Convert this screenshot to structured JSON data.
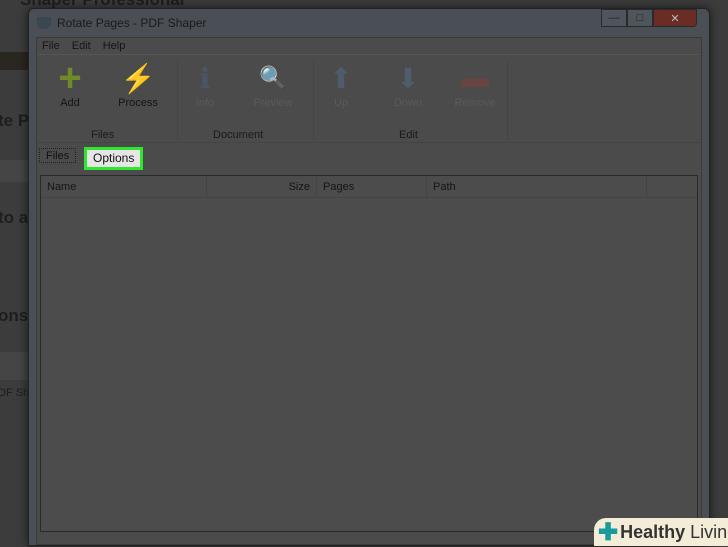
{
  "background": {
    "fragments": [
      "Shaper Professional",
      "te Pa",
      "to ad",
      "ons f",
      "DF Sha"
    ]
  },
  "window": {
    "title": "Rotate Pages - PDF Shaper",
    "minimize": "—",
    "maximize": "□",
    "close": "✕"
  },
  "menu": [
    "File",
    "Edit",
    "Help"
  ],
  "toolbar": {
    "buttons": [
      {
        "label": "Add",
        "icon": "+",
        "enabled": true
      },
      {
        "label": "Process",
        "icon": "⚡",
        "enabled": true
      },
      {
        "label": "Info",
        "icon": "ℹ",
        "enabled": false
      },
      {
        "label": "Preview",
        "icon": "🔍",
        "enabled": false
      },
      {
        "label": "Up",
        "icon": "⬆",
        "enabled": false
      },
      {
        "label": "Down",
        "icon": "⬇",
        "enabled": false
      },
      {
        "label": "Remove",
        "icon": "▬",
        "enabled": false
      }
    ],
    "groups": [
      "Files",
      "Document",
      "Edit"
    ]
  },
  "tabs": [
    "Files",
    "Options"
  ],
  "table": {
    "columns": [
      "Name",
      "Size",
      "Pages",
      "Path"
    ],
    "rows": []
  },
  "watermark": {
    "text_bold": "Healthy",
    "text": "Living"
  },
  "colors": {
    "highlight": "#2ee62e"
  }
}
